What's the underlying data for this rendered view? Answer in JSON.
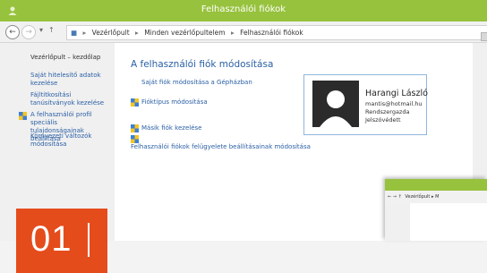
{
  "window": {
    "title": "Felhasználói fiókok",
    "accent": "#97c23d"
  },
  "breadcrumb": [
    "Vezérlőpult",
    "Minden vezérlőpultelem",
    "Felhasználói fiókok"
  ],
  "sidebar": {
    "home": "Vezérlőpult – kezdőlap",
    "items": [
      "Saját hitelesítő adatok kezelése",
      "Fájltitkosítási tanúsítványok kezelése",
      "A felhasználói profil speciális tulajdonságainak beállítása",
      "Környezeti változók módosítása"
    ]
  },
  "main": {
    "title": "A felhasználói fiók módosítása",
    "links": [
      "Saját fiók módosítása a Gépházban",
      "Fióktípus módosítása",
      "Másik fiók kezelése",
      "Felhasználói fiókok felügyelete beállításainak módosítása"
    ]
  },
  "user": {
    "name": "Harangi László",
    "email": "mantis@hotmail.hu",
    "role": "Rendszergazda",
    "status": "Jelszóvédett"
  },
  "step_badge": {
    "number": "01",
    "color": "#e54c1c"
  },
  "overlay": {
    "breadcrumb_short": "Vezérlőpult ▸ M"
  }
}
